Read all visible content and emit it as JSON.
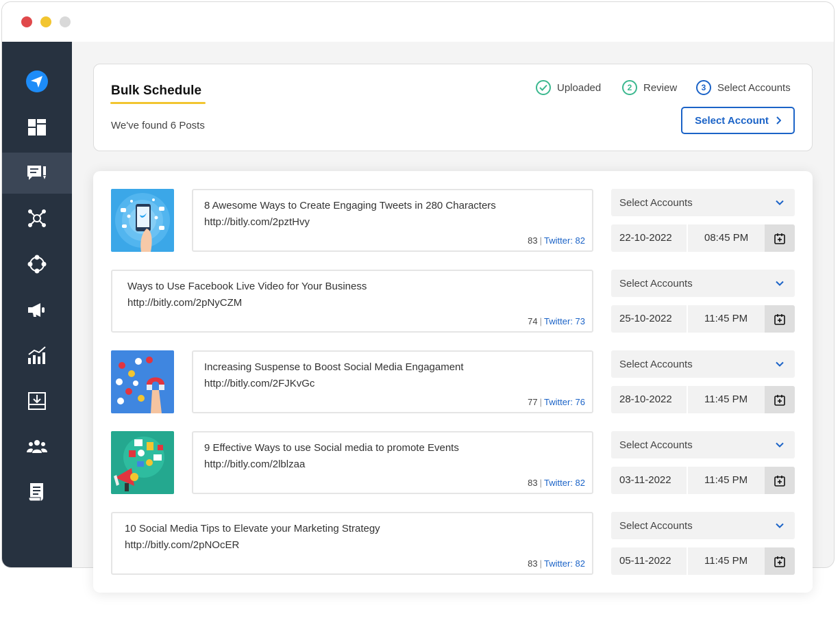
{
  "header": {
    "title": "Bulk Schedule",
    "found_text": "We've found 6 Posts",
    "steps": [
      {
        "label": "Uploaded",
        "marker": ""
      },
      {
        "label": "Review",
        "marker": "2"
      },
      {
        "label": "Select Accounts",
        "marker": "3"
      }
    ],
    "select_account_button": "Select Account"
  },
  "posts": [
    {
      "title": "8 Awesome Ways to Create Engaging Tweets in 280 Characters",
      "link": "http://bitly.com/2pztHvy",
      "count": "83",
      "twitter": "Twitter: 82",
      "accounts_placeholder": "Select Accounts",
      "date": "22-10-2022",
      "time": "08:45 PM"
    },
    {
      "title": "Ways to Use Facebook Live Video for Your Business",
      "link": "http://bitly.com/2pNyCZM",
      "count": "74",
      "twitter": "Twitter: 73",
      "accounts_placeholder": "Select Accounts",
      "date": "25-10-2022",
      "time": "11:45 PM"
    },
    {
      "title": "Increasing Suspense to Boost Social Media Engagament",
      "link": "http://bitly.com/2FJKvGc",
      "count": "77",
      "twitter": "Twitter: 76",
      "accounts_placeholder": "Select Accounts",
      "date": "28-10-2022",
      "time": "11:45 PM"
    },
    {
      "title": "9 Effective Ways to use Social media to promote Events",
      "link": "http://bitly.com/2lblzaa",
      "count": "83",
      "twitter": "Twitter: 82",
      "accounts_placeholder": "Select Accounts",
      "date": "03-11-2022",
      "time": "11:45 PM"
    },
    {
      "title": "10 Social Media Tips to Elevate your Marketing Strategy",
      "link": "http://bitly.com/2pNOcER",
      "count": "83",
      "twitter": "Twitter: 82",
      "accounts_placeholder": "Select Accounts",
      "date": "05-11-2022",
      "time": "11:45 PM"
    }
  ],
  "sidebar": {
    "icons": [
      "send-logo-icon",
      "dashboard-icon",
      "posts-icon",
      "network-icon",
      "connect-icon",
      "megaphone-icon",
      "analytics-icon",
      "inbox-download-icon",
      "team-icon",
      "reports-icon"
    ],
    "active_index": 2
  },
  "colors": {
    "accent_blue": "#1b63c7",
    "success_green": "#3bb88f",
    "highlight_yellow": "#f2c530",
    "sidebar_bg": "#273240"
  }
}
